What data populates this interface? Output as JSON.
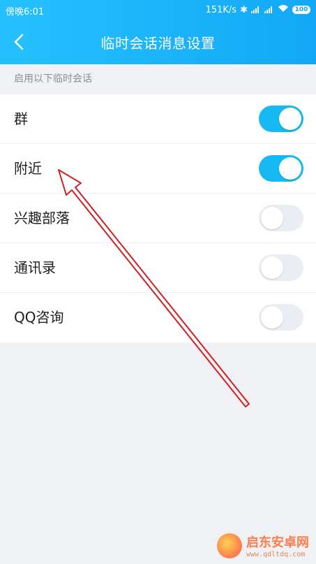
{
  "status_bar": {
    "time": "傍晚6:01",
    "network_speed": "151K/s",
    "battery": "100"
  },
  "header": {
    "title": "临时会话消息设置"
  },
  "section": {
    "label": "启用以下临时会话"
  },
  "rows": [
    {
      "label": "群",
      "enabled": true
    },
    {
      "label": "附近",
      "enabled": true
    },
    {
      "label": "兴趣部落",
      "enabled": false
    },
    {
      "label": "通讯录",
      "enabled": false
    },
    {
      "label": "QQ咨询",
      "enabled": false
    }
  ],
  "watermark": {
    "text": "启东安卓网",
    "url": "www.qdltdq.com"
  },
  "colors": {
    "header_start": "#25c1ff",
    "header_end": "#12a8f6",
    "toggle_on": "#16b9f2",
    "toggle_off": "#eaedf3",
    "arrow": "#d21f1f"
  }
}
